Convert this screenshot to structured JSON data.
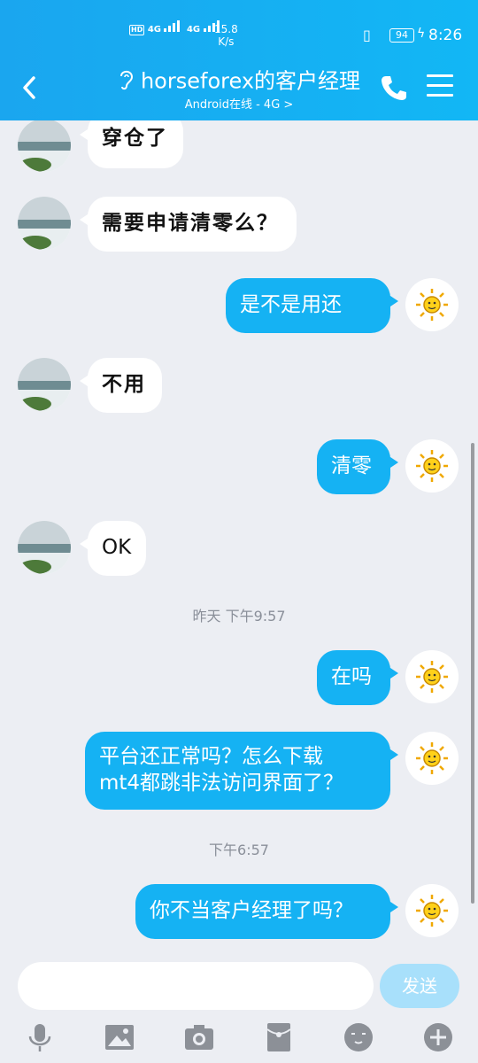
{
  "status_bar": {
    "hd_label": "HD",
    "net1": "4G",
    "net2": "4G",
    "speed_value": "15.8",
    "speed_unit": "K/s",
    "battery": "94",
    "time": "8:26"
  },
  "header": {
    "title": "horseforex的客户经理",
    "subtitle": "Android在线 - 4G >"
  },
  "messages": [
    {
      "side": "in",
      "text": "穿仓了"
    },
    {
      "side": "in",
      "text": "需要申请清零么？"
    },
    {
      "side": "out",
      "text": "是不是用还"
    },
    {
      "side": "in",
      "text": "不用"
    },
    {
      "side": "out",
      "text": "清零"
    },
    {
      "side": "in",
      "text": "OK"
    },
    {
      "type": "timestamp",
      "text": "昨天 下午9:57"
    },
    {
      "side": "out",
      "text": "在吗"
    },
    {
      "side": "out",
      "text": "平台还正常吗？怎么下载\nmt4都跳非法访问界面了？"
    },
    {
      "type": "timestamp",
      "text": "下午6:57"
    },
    {
      "side": "out",
      "text": "你不当客户经理了吗？"
    }
  ],
  "composer": {
    "placeholder": "",
    "send_label": "发送"
  },
  "toolbar_icons": [
    "microphone-icon",
    "image-icon",
    "camera-icon",
    "red-packet-icon",
    "emoji-icon",
    "plus-icon"
  ],
  "colors": {
    "header_bg": "#12b7f5",
    "out_bubble": "#15b2f3",
    "in_bubble": "#ffffff",
    "chat_bg": "#eceef3",
    "send_disabled": "#a8e0fb"
  }
}
